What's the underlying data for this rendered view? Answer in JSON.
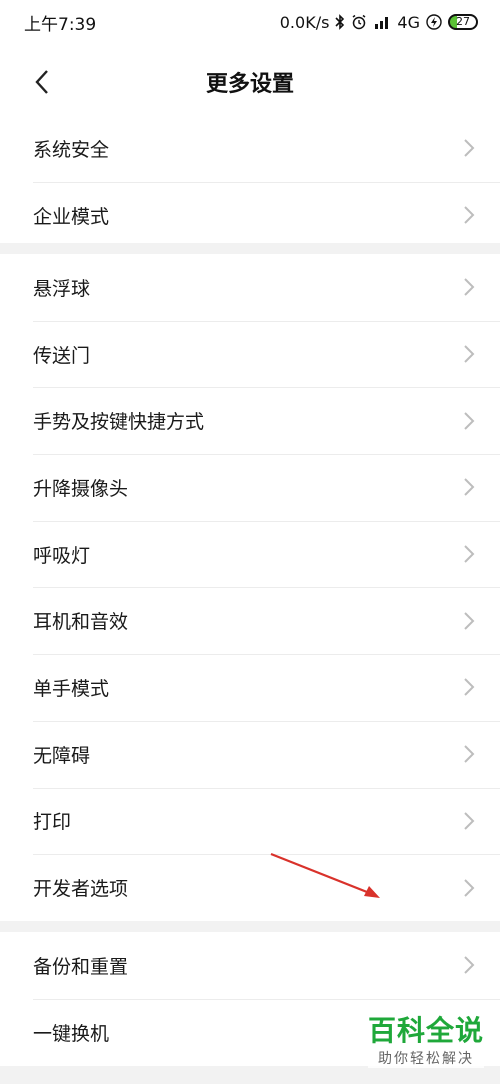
{
  "status_bar": {
    "time": "上午7:39",
    "net_speed": "0.0K/s",
    "network": "4G",
    "battery": "27"
  },
  "header": {
    "title": "更多设置"
  },
  "groups": [
    {
      "items": [
        {
          "label": "系统安全"
        },
        {
          "label": "企业模式"
        }
      ]
    },
    {
      "items": [
        {
          "label": "悬浮球"
        },
        {
          "label": "传送门"
        },
        {
          "label": "手势及按键快捷方式"
        },
        {
          "label": "升降摄像头"
        },
        {
          "label": "呼吸灯"
        },
        {
          "label": "耳机和音效"
        },
        {
          "label": "单手模式"
        },
        {
          "label": "无障碍"
        },
        {
          "label": "打印"
        },
        {
          "label": "开发者选项"
        }
      ]
    },
    {
      "items": [
        {
          "label": "备份和重置"
        },
        {
          "label": "一键换机"
        }
      ]
    }
  ],
  "colors": {
    "divider": "#f2f2f2",
    "chevron": "#bdbdbd",
    "arrow": "#d9322b",
    "watermark": "#1fa83a",
    "battery": "#5bc236"
  },
  "watermark": {
    "main": "百科全说",
    "sub": "助你轻松解决"
  }
}
